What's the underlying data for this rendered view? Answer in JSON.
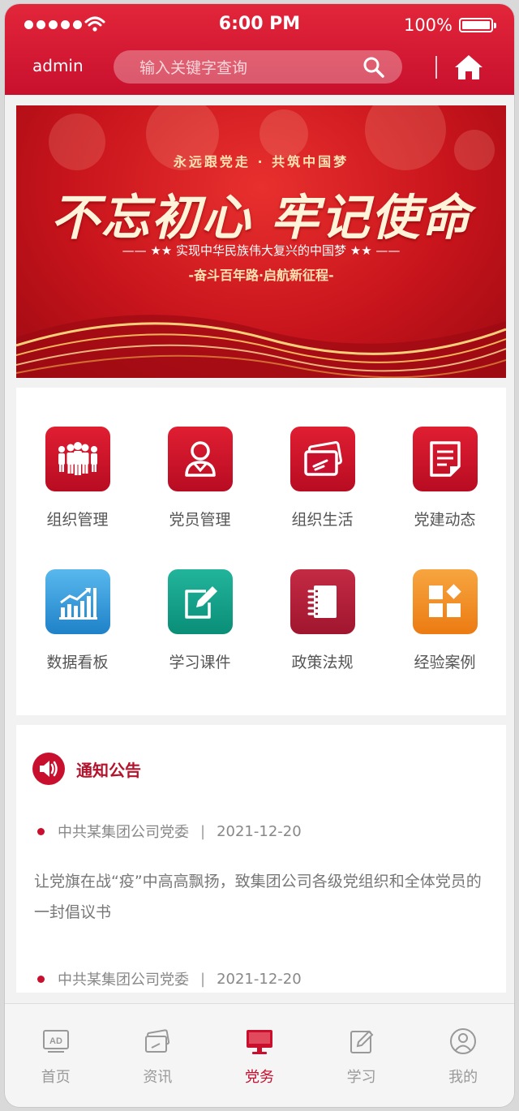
{
  "status": {
    "time": "6:00 PM",
    "battery": "100%"
  },
  "header": {
    "user": "admin",
    "search_placeholder": "输入关键字查询"
  },
  "banner": {
    "top": "永远跟党走 · 共筑中国梦",
    "main": "不忘初心 牢记使命",
    "sub": "—— ★★ 实现中华民族伟大复兴的中国梦 ★★ ——",
    "sub2": "-奋斗百年路·启航新征程-"
  },
  "grid": [
    {
      "label": "组织管理",
      "icon": "people-icon",
      "color": "#c8102e"
    },
    {
      "label": "党员管理",
      "icon": "member-icon",
      "color": "#c8102e"
    },
    {
      "label": "组织生活",
      "icon": "cards-icon",
      "color": "#c8102e"
    },
    {
      "label": "党建动态",
      "icon": "document-icon",
      "color": "#c8102e"
    },
    {
      "label": "数据看板",
      "icon": "chart-icon",
      "color": "#2a8fd0"
    },
    {
      "label": "学习课件",
      "icon": "edit-icon",
      "color": "#14a08a"
    },
    {
      "label": "政策法规",
      "icon": "notebook-icon",
      "color": "#b5203a"
    },
    {
      "label": "经验案例",
      "icon": "apps-icon",
      "color": "#f08a1e"
    }
  ],
  "notice": {
    "title": "通知公告",
    "items": [
      {
        "org": "中共某集团公司党委",
        "date": "2021-12-20",
        "text": "让党旗在战“疫”中高高飘扬，致集团公司各级党组织和全体党员的一封倡议书"
      },
      {
        "org": "中共某集团公司党委",
        "date": "2021-12-20"
      }
    ]
  },
  "tabs": [
    {
      "label": "首页",
      "icon": "ad-icon"
    },
    {
      "label": "资讯",
      "icon": "news-icon"
    },
    {
      "label": "党务",
      "icon": "monitor-icon",
      "active": true
    },
    {
      "label": "学习",
      "icon": "pencil-icon"
    },
    {
      "label": "我的",
      "icon": "user-icon"
    }
  ],
  "colors": {
    "primary": "#c8102e",
    "accent_blue": "#2a8fd0",
    "accent_teal": "#14a08a",
    "accent_orange": "#f08a1e"
  }
}
